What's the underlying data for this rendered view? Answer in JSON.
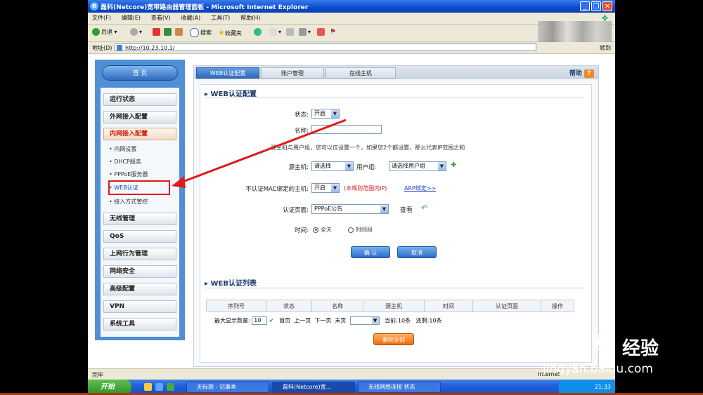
{
  "window": {
    "title": "磊科(Netcore)宽带路由器管理面板 - Microsoft Internet Explorer",
    "controls": [
      "_",
      "❐",
      "✕"
    ]
  },
  "menubar": [
    "文件(F)",
    "编辑(E)",
    "查看(V)",
    "收藏(A)",
    "工具(T)",
    "帮助(H)"
  ],
  "toolbar": {
    "back": "后退",
    "search": "搜索",
    "favorites": "收藏夹",
    "back_color": "#2e9e2e",
    "go_label": "转到"
  },
  "address": {
    "label": "地址(D)",
    "url": "http://10.23.10.1/",
    "go": "转到"
  },
  "sidebar": {
    "home": "首 页",
    "items": [
      {
        "label": "运行状态"
      },
      {
        "label": "外网接入配置"
      },
      {
        "label": "内网接入配置"
      },
      {
        "label": "无线管理"
      },
      {
        "label": "QoS"
      },
      {
        "label": "上网行为管理"
      },
      {
        "label": "网络安全"
      },
      {
        "label": "高级配置"
      },
      {
        "label": "VPN"
      },
      {
        "label": "系统工具"
      }
    ],
    "subitems": [
      "内网设置",
      "DHCP服务",
      "PPPoE服务器",
      "WEB认证",
      "接入方式管控"
    ],
    "selected_sub": "WEB认证"
  },
  "tabs": [
    "WEB认证配置",
    "账户管理",
    "在线主机"
  ],
  "help": {
    "label": "帮助",
    "icon": "?"
  },
  "config": {
    "section_title": "WEB认证配置",
    "status_label": "状态:",
    "status_value": "开启",
    "name_label": "名称:",
    "name_value": "",
    "note": "源主机与用户组，您可以仅设置一个，如果您2个都设置，那么代表IP范围之和",
    "source_label": "源主机:",
    "source_value": "请选择",
    "group_label": "用户组:",
    "group_value": "请选择用户组",
    "mac_label": "不认证MAC绑定的主机:",
    "mac_value": "开启",
    "mac_note": "(本规则范围内IP)",
    "arp_link": "ARP绑定>>",
    "page_label": "认证页面:",
    "page_value": "PPPoE公告",
    "view_label": "查看",
    "time_label": "时间:",
    "time_options": [
      "全天",
      "时间段"
    ],
    "time_selected": "全天",
    "confirm": "确 认",
    "cancel": "取消"
  },
  "list": {
    "section_title": "WEB认证列表",
    "columns": [
      "序列号",
      "状态",
      "名称",
      "源主机",
      "时间",
      "认证页面",
      "操作"
    ],
    "max_label": "最大显示数量:",
    "max_value": "10",
    "first": "首页",
    "prev": "上一页",
    "next": "下一页",
    "last": "末页",
    "current": "当前:10条",
    "total": "还剩:10条",
    "delete_all": "删除全部"
  },
  "statusbar": {
    "left": "完毕",
    "right": "Internet"
  },
  "taskbar": {
    "start": "开始",
    "tasks": [
      "无标题 - 记事本",
      "磊科(Netcore)宽...",
      "无线网络连接 状态"
    ],
    "clock": "21:33"
  },
  "watermark": {
    "brand": "Bai",
    "jingyan": "经验",
    "url": "jingyan.baidu.com"
  },
  "colors": {
    "accent_blue": "#2f69b9",
    "alert_red": "#e01a1a",
    "orange": "#ee6d10"
  }
}
